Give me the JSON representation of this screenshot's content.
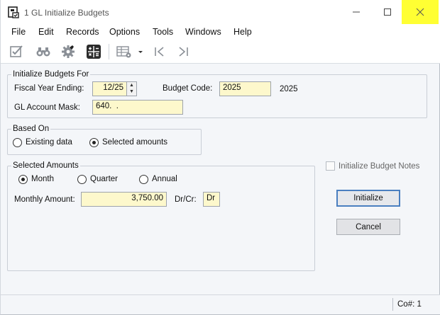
{
  "window": {
    "title": "1 GL Initialize Budgets"
  },
  "menu": [
    "File",
    "Edit",
    "Records",
    "Options",
    "Tools",
    "Windows",
    "Help"
  ],
  "toolbar_icons": [
    "check-edit-icon",
    "binoculars-icon",
    "gear-icon",
    "calculator-icon",
    "grid-settings-icon",
    "chevron-down-icon",
    "first-record-icon",
    "last-record-icon"
  ],
  "init_group": {
    "label": "Initialize Budgets For",
    "fiscal_year_label": "Fiscal Year Ending:",
    "fiscal_year_value": "12/25",
    "budget_code_label": "Budget Code:",
    "budget_code_value": "2025",
    "budget_code_desc": "2025",
    "account_mask_label": "GL Account Mask:",
    "account_mask_value": "640.  ."
  },
  "based_on": {
    "label": "Based On",
    "option_existing": "Existing data",
    "option_selected": "Selected amounts",
    "selected": "Selected amounts"
  },
  "selected_amounts": {
    "label": "Selected Amounts",
    "option_month": "Month",
    "option_quarter": "Quarter",
    "option_annual": "Annual",
    "selected": "Month",
    "monthly_amount_label": "Monthly Amount:",
    "monthly_amount_value": "3,750.00",
    "drcr_label": "Dr/Cr:",
    "drcr_value": "Dr"
  },
  "notes_checkbox_label": "Initialize Budget Notes",
  "buttons": {
    "initialize": "Initialize",
    "cancel": "Cancel"
  },
  "status": {
    "company": "Co#: 1"
  },
  "colors": {
    "field_bg": "#fdf8cc",
    "close_highlight": "#ffff33",
    "default_button_border": "#4a7fc0"
  }
}
